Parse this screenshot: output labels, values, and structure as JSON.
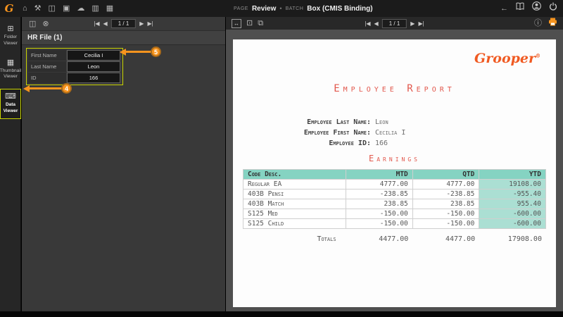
{
  "colors": {
    "orange": "#f7941e",
    "highlight_yellow": "#c9d400",
    "teal_header": "#85d3c2",
    "teal_cell": "#abdfd3",
    "doc_red": "#e2574c"
  },
  "icons": {
    "home": "⌂",
    "tools": "⚒",
    "save": "◫",
    "briefcase": "▣",
    "cloud": "☁",
    "chart": "▥",
    "stats": "▦",
    "back": "←",
    "close": "⊗",
    "info": "ⓘ",
    "fit_width": "↔",
    "page_view": "⊡",
    "multipage": "⧉",
    "folder_viewer": "⊞",
    "thumbnail_viewer": "▦",
    "data_viewer": "⌨",
    "nav_first": "|◀",
    "nav_prev": "◀",
    "nav_next": "▶",
    "nav_last": "▶|"
  },
  "topbar": {
    "logo": "G",
    "page_label": "PAGE",
    "page_value": "Review",
    "dot": "•",
    "batch_label": "BATCH",
    "batch_value": "Box (CMIS Binding)"
  },
  "sidebar": {
    "items": [
      {
        "label": "Folder\nViewer"
      },
      {
        "label": "Thumbnail\nViewer"
      },
      {
        "label": "Data\nViewer"
      }
    ]
  },
  "data_panel": {
    "counter": "1 / 1",
    "title": "HR File (1)",
    "fields": [
      {
        "label": "First Name",
        "value": "Cecilia I"
      },
      {
        "label": "Last Name",
        "value": "Leon"
      },
      {
        "label": "ID",
        "value": "166"
      }
    ]
  },
  "viewer": {
    "counter": "1 / 1"
  },
  "callouts": {
    "data_viewer": "4",
    "index_fields": "5"
  },
  "document": {
    "brand": "Grooper",
    "brand_reg": "®",
    "title": "Employee Report",
    "fields": [
      {
        "label": "Employee Last Name:",
        "value": "Leon"
      },
      {
        "label": "Employee First Name:",
        "value": "Cecilia I"
      },
      {
        "label": "Employee ID:",
        "value": "166"
      }
    ],
    "section": "Earnings",
    "table": {
      "headers": [
        "Code Desc.",
        "MTD",
        "QTD",
        "YTD"
      ],
      "rows": [
        [
          "Regular EA",
          "4777.00",
          "4777.00",
          "19108.00"
        ],
        [
          "403B Pensi",
          "-238.85",
          "-238.85",
          "-955.40"
        ],
        [
          "403B Match",
          "238.85",
          "238.85",
          "955.40"
        ],
        [
          "S125 Med",
          "-150.00",
          "-150.00",
          "-600.00"
        ],
        [
          "S125 Child",
          "-150.00",
          "-150.00",
          "-600.00"
        ]
      ],
      "totals_label": "Totals",
      "totals": [
        "4477.00",
        "4477.00",
        "17908.00"
      ]
    }
  }
}
